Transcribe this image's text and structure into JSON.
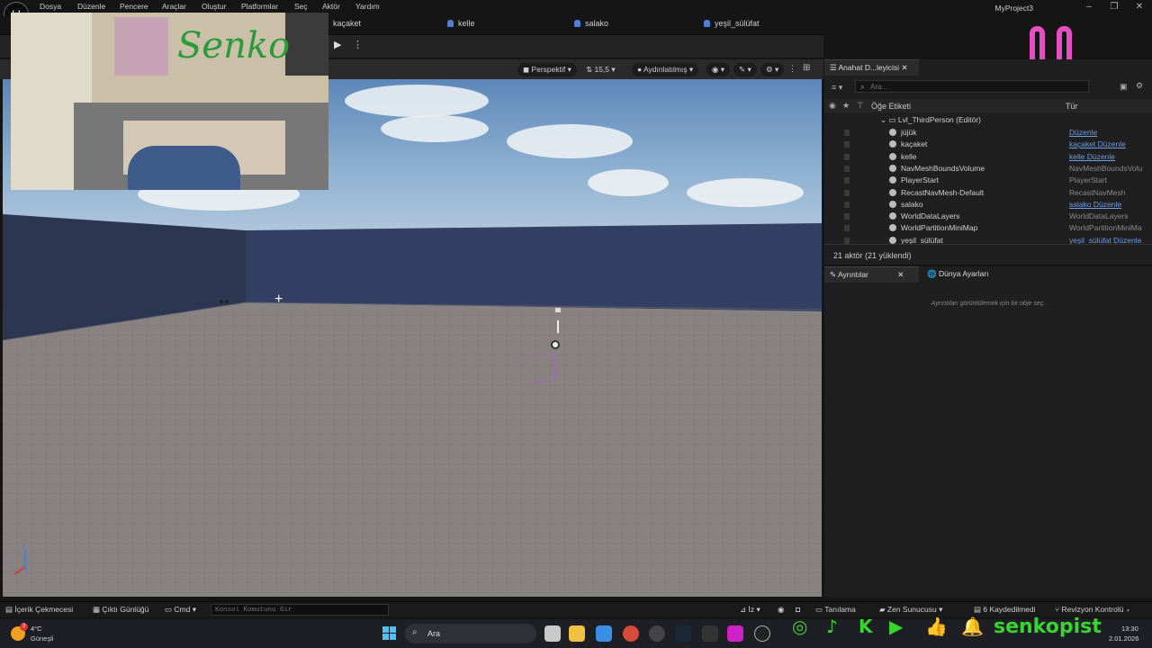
{
  "menu": [
    "Dosya",
    "Düzenle",
    "Pencere",
    "Araçlar",
    "Oluştur",
    "Platformlar",
    "Seç",
    "Aktör",
    "Yardım"
  ],
  "window_title": "MyProject3",
  "player_tabs": [
    "kaçaket",
    "kelle",
    "salako",
    "yeşil_sülüfat"
  ],
  "viewport_toolbar": {
    "perspective": "Perspektif",
    "fov": "15,5",
    "lighting": "Aydınlatılmış"
  },
  "outliner": {
    "tab_title": "Anahat D...leyicisi",
    "search_placeholder": "Ara...",
    "col_label": "Öğe Etiketi",
    "col_type": "Tür",
    "level": "Lvl_ThirdPerson (Editör)",
    "rows": [
      {
        "name": "jüjük",
        "type": "Düzenle",
        "link": true
      },
      {
        "name": "kaçaket",
        "type": "kaçaket Düzenle",
        "link": true
      },
      {
        "name": "kelle",
        "type": "kelle Düzenle",
        "link": true
      },
      {
        "name": "NavMeshBoundsVolume",
        "type": "NavMeshBoundsVolu",
        "link": false
      },
      {
        "name": "PlayerStart",
        "type": "PlayerStart",
        "link": false
      },
      {
        "name": "RecastNavMesh-Default",
        "type": "RecastNavMesh",
        "link": false
      },
      {
        "name": "salako",
        "type": "salako Düzenle",
        "link": true
      },
      {
        "name": "WorldDataLayers",
        "type": "WorldDataLayers",
        "link": false
      },
      {
        "name": "WorldPartitionMiniMap",
        "type": "WorldPartitionMiniMa",
        "link": false
      },
      {
        "name": "yeşil_sülüfat",
        "type": "yeşil_sülüfat Düzenle",
        "link": true
      }
    ],
    "footer": "21 aktör (21 yüklendi)"
  },
  "details": {
    "tab_details": "Ayrıntılar",
    "tab_world": "Dünya Ayarları",
    "empty_msg": "Ayrıntıları görüntülemek için bir obje seç."
  },
  "statusbar": {
    "content_drawer": "İçerik Çekmecesi",
    "output_log": "Çıktı Günlüğü",
    "cmd": "Cmd",
    "console_placeholder": "Konsol Komutunu Gir",
    "trace": "İz",
    "diagnostics": "Tanılama",
    "zen_server": "Zen Sunucusu",
    "saved": "6 Kaydedilmedi",
    "revision": "Revizyon Kontrolü"
  },
  "taskbar": {
    "temp": "4°C",
    "weather": "Güneşli",
    "weather_badge": "3",
    "search": "Ara",
    "time": "13:30",
    "date": "2.01.2026"
  },
  "overlay": {
    "webcam_text": "Senko",
    "handle": "senkopist"
  },
  "colors": {
    "accent": "#4f7fd6",
    "link": "#6d9ee6",
    "social_green": "#38d430",
    "smiley_pink": "#e64fc4"
  }
}
